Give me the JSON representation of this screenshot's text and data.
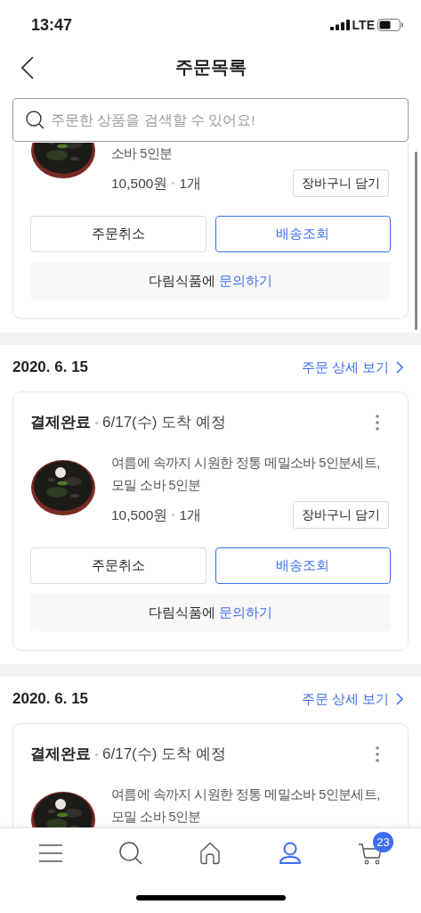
{
  "status_bar": {
    "time": "13:47",
    "network": "LTE"
  },
  "header": {
    "title": "주문목록"
  },
  "search": {
    "placeholder": "주문한 상품을 검색할 수 있어요!"
  },
  "orders": [
    {
      "product": {
        "name": "소바 5인분",
        "price": "10,500원",
        "quantity": "1개",
        "cart_button": "장바구니 담기"
      },
      "buttons": [
        {
          "label": "주문취소",
          "kind": "default"
        },
        {
          "label": "배송조회",
          "kind": "primary"
        }
      ],
      "inquiry": {
        "seller": "다림식품에",
        "link": "문의하기"
      }
    },
    {
      "date": "2020. 6. 15",
      "detail_link": "주문 상세 보기",
      "status": "결제완료",
      "eta": "6/17(수) 도착 예정",
      "product": {
        "name": "여름에 속까지 시원한 정통 메밀소바 5인분세트, 모밀 소바 5인분",
        "price": "10,500원",
        "quantity": "1개",
        "cart_button": "장바구니 담기"
      },
      "buttons": [
        {
          "label": "주문취소",
          "kind": "default"
        },
        {
          "label": "배송조회",
          "kind": "primary"
        }
      ],
      "inquiry": {
        "seller": "다림식품에",
        "link": "문의하기"
      }
    },
    {
      "date": "2020. 6. 15",
      "detail_link": "주문 상세 보기",
      "status": "결제완료",
      "eta": "6/17(수) 도착 예정",
      "product": {
        "name": "여름에 속까지 시원한 정통 메밀소바 5인분세트, 모밀 소바 5인분"
      }
    }
  ],
  "tab_bar": {
    "items": [
      {
        "kind": "menu",
        "selected": false
      },
      {
        "kind": "search",
        "selected": false
      },
      {
        "kind": "home",
        "selected": false
      },
      {
        "kind": "account",
        "selected": true
      },
      {
        "kind": "cart",
        "selected": false,
        "badge": "23"
      }
    ]
  }
}
